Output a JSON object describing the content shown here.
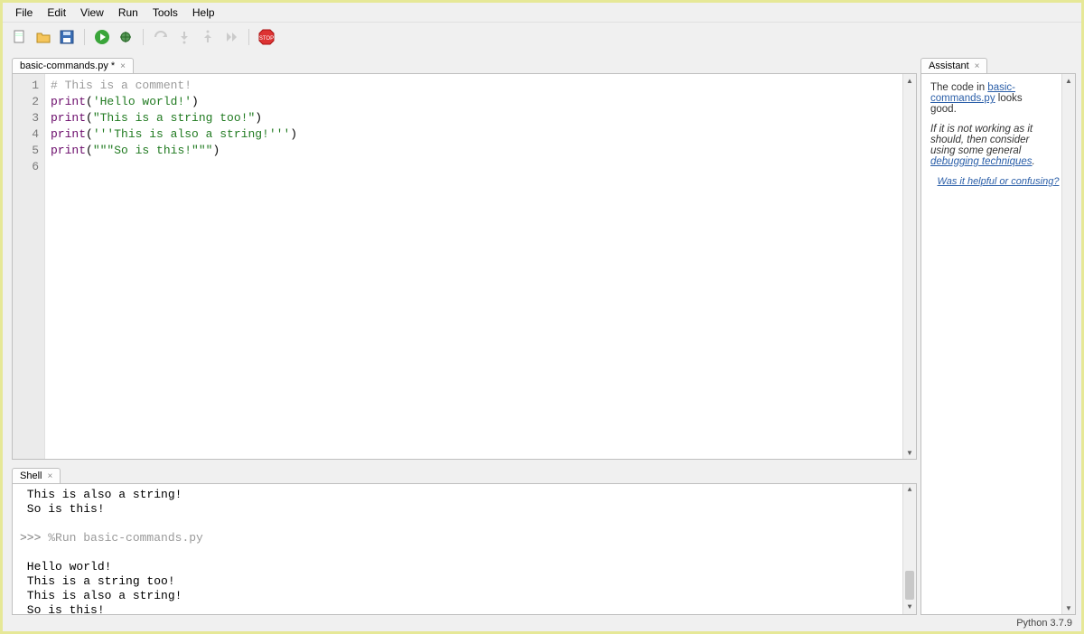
{
  "menu": [
    "File",
    "Edit",
    "View",
    "Run",
    "Tools",
    "Help"
  ],
  "toolbar": {
    "new_icon": "new-file-icon",
    "open_icon": "open-folder-icon",
    "save_icon": "save-icon",
    "run_icon": "run-icon",
    "debug_icon": "debug-icon",
    "undo_icon": "undo-icon",
    "redo_icon": "redo-icon",
    "stepover_icon": "step-over-icon",
    "stepinto_icon": "step-into-icon",
    "resume_icon": "resume-icon",
    "stop_icon": "stop-icon"
  },
  "editor": {
    "tab_label": "basic-commands.py *",
    "lines": [
      {
        "n": "1",
        "segments": [
          {
            "cls": "tok-comment",
            "t": "# This is a comment!"
          }
        ]
      },
      {
        "n": "2",
        "segments": [
          {
            "cls": "tok-func",
            "t": "print"
          },
          {
            "cls": "tok-paren",
            "t": "("
          },
          {
            "cls": "tok-str",
            "t": "'Hello world!'"
          },
          {
            "cls": "tok-paren",
            "t": ")"
          }
        ]
      },
      {
        "n": "3",
        "segments": [
          {
            "cls": "tok-func",
            "t": "print"
          },
          {
            "cls": "tok-paren",
            "t": "("
          },
          {
            "cls": "tok-str",
            "t": "\"This is a string too!\""
          },
          {
            "cls": "tok-paren",
            "t": ")"
          }
        ]
      },
      {
        "n": "4",
        "segments": [
          {
            "cls": "tok-func",
            "t": "print"
          },
          {
            "cls": "tok-paren",
            "t": "("
          },
          {
            "cls": "tok-str",
            "t": "'''This is also a string!'''"
          },
          {
            "cls": "tok-paren",
            "t": ")"
          }
        ]
      },
      {
        "n": "5",
        "segments": [
          {
            "cls": "tok-func",
            "t": "print"
          },
          {
            "cls": "tok-paren",
            "t": "("
          },
          {
            "cls": "tok-str",
            "t": "\"\"\"So is this!\"\"\""
          },
          {
            "cls": "tok-paren",
            "t": ")"
          }
        ]
      },
      {
        "n": "6",
        "segments": []
      }
    ]
  },
  "shell": {
    "tab_label": "Shell",
    "lines": [
      {
        "kind": "out",
        "t": " This is also a string!"
      },
      {
        "kind": "out",
        "t": " So is this!"
      },
      {
        "kind": "blank",
        "t": ""
      },
      {
        "kind": "run",
        "prompt": ">>> ",
        "cmd": "%Run basic-commands.py"
      },
      {
        "kind": "blank",
        "t": ""
      },
      {
        "kind": "out",
        "t": " Hello world!"
      },
      {
        "kind": "out",
        "t": " This is a string too!"
      },
      {
        "kind": "out",
        "t": " This is also a string!"
      },
      {
        "kind": "out",
        "t": " So is this!"
      },
      {
        "kind": "prompt",
        "prompt": ">>> "
      }
    ]
  },
  "assistant": {
    "tab_label": "Assistant",
    "p1_a": "The code in ",
    "p1_link": "basic-commands.py",
    "p1_b": " looks good.",
    "p2_a": "If it is not working as it should, then consider using some general ",
    "p2_link": "debugging techniques",
    "p2_b": ".",
    "helpful": "Was it helpful or confusing?"
  },
  "status": {
    "python_version": "Python 3.7.9"
  }
}
